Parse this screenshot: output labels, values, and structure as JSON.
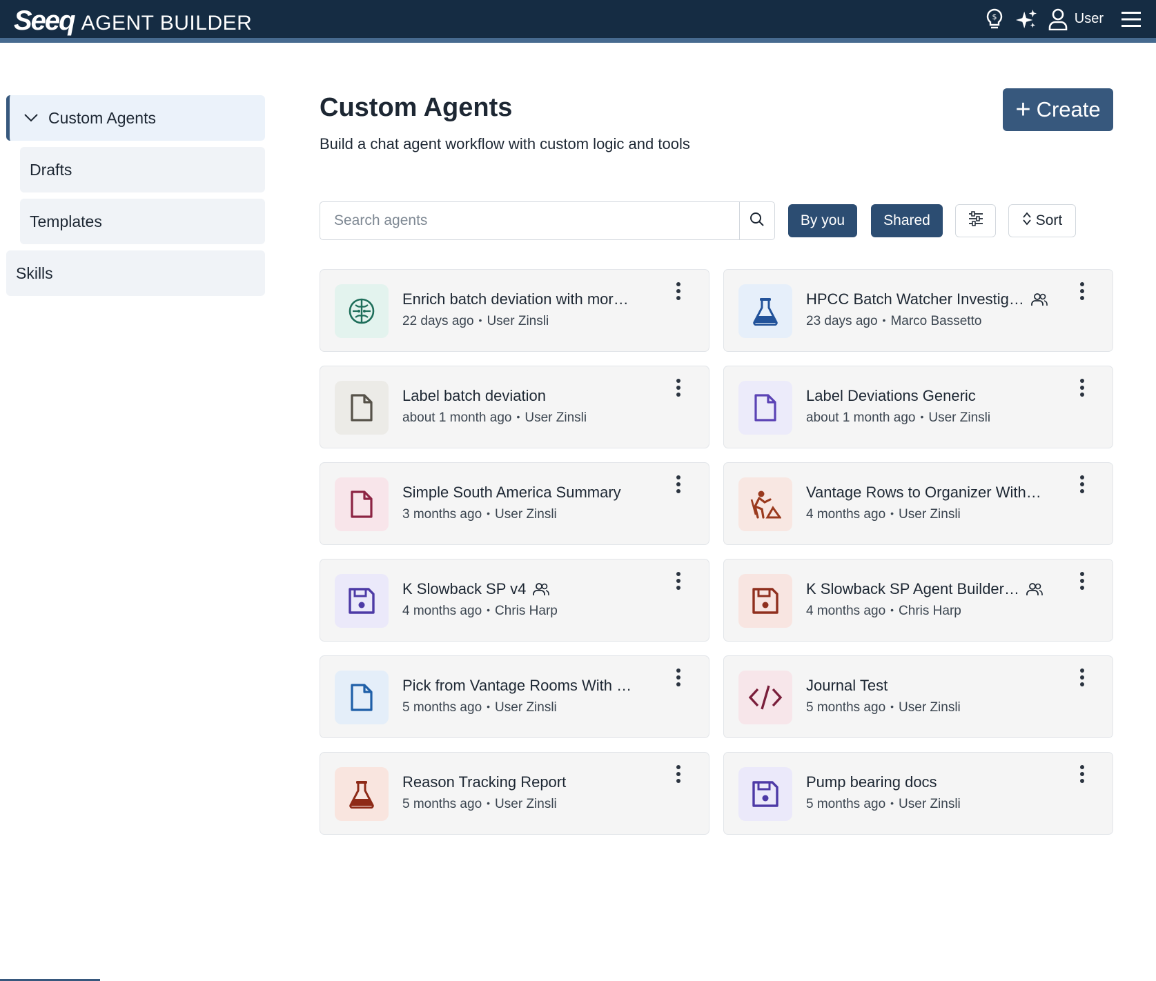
{
  "header": {
    "logo": "Seeq",
    "app_title": "AGENT BUILDER",
    "user_label": "User",
    "icons": [
      "lightbulb-dollar-icon",
      "sparkles-icon",
      "user-icon",
      "hamburger-menu-icon"
    ]
  },
  "sidebar": {
    "items": [
      {
        "label": "Custom Agents",
        "active": true
      },
      {
        "label": "Drafts"
      },
      {
        "label": "Templates"
      },
      {
        "label": "Skills"
      }
    ]
  },
  "main": {
    "title": "Custom Agents",
    "subtitle": "Build a chat agent workflow with custom logic and tools",
    "create_label": "Create",
    "search_placeholder": "Search agents",
    "filters": {
      "by_you": "By you",
      "shared": "Shared"
    },
    "sort_label": "Sort"
  },
  "cards": [
    {
      "title": "Enrich batch deviation with mor…",
      "age": "22 days ago",
      "author": "User Zinsli",
      "icon": "brain-icon",
      "icon_bg": "#e3f3ee",
      "icon_color": "#1e6e5a",
      "shared": false
    },
    {
      "title": "HPCC Batch Watcher Investig…",
      "age": "23 days ago",
      "author": "Marco Bassetto",
      "icon": "flask-icon",
      "icon_bg": "#e6effa",
      "icon_color": "#23539a",
      "shared": true
    },
    {
      "title": "Label batch deviation",
      "age": "about 1 month ago",
      "author": "User Zinsli",
      "icon": "file-icon",
      "icon_bg": "#ecebe7",
      "icon_color": "#565249",
      "shared": false
    },
    {
      "title": "Label Deviations Generic",
      "age": "about 1 month ago",
      "author": "User Zinsli",
      "icon": "file-icon",
      "icon_bg": "#ecebfa",
      "icon_color": "#5b43b5",
      "shared": false
    },
    {
      "title": "Simple South America Summary",
      "age": "3 months ago",
      "author": "User Zinsli",
      "icon": "file-icon",
      "icon_bg": "#f8e5ea",
      "icon_color": "#8c2443",
      "shared": false
    },
    {
      "title": "Vantage Rows to Organizer With…",
      "age": "4 months ago",
      "author": "User Zinsli",
      "icon": "person-digging-icon",
      "icon_bg": "#f8e7e2",
      "icon_color": "#9a3a1e",
      "shared": false
    },
    {
      "title": "K Slowback SP v4",
      "age": "4 months ago",
      "author": "Chris Harp",
      "icon": "floppy-disk-icon",
      "icon_bg": "#ebe9fa",
      "icon_color": "#4d3aa6",
      "shared": true
    },
    {
      "title": "K Slowback SP Agent Builder…",
      "age": "4 months ago",
      "author": "Chris Harp",
      "icon": "floppy-disk-icon",
      "icon_bg": "#f8e5e1",
      "icon_color": "#8f2f1e",
      "shared": true
    },
    {
      "title": "Pick from Vantage Rooms With …",
      "age": "5 months ago",
      "author": "User Zinsli",
      "icon": "file-icon",
      "icon_bg": "#e4eef9",
      "icon_color": "#1f5fa8",
      "shared": false
    },
    {
      "title": "Journal Test",
      "age": "5 months ago",
      "author": "User Zinsli",
      "icon": "code-icon",
      "icon_bg": "#f7e6ea",
      "icon_color": "#7a1f3b",
      "shared": false
    },
    {
      "title": "Reason Tracking Report",
      "age": "5 months ago",
      "author": "User Zinsli",
      "icon": "flask-icon",
      "icon_bg": "#f9e5df",
      "icon_color": "#8e2a17",
      "shared": false
    },
    {
      "title": "Pump bearing docs",
      "age": "5 months ago",
      "author": "User Zinsli",
      "icon": "floppy-disk-icon",
      "icon_bg": "#ebe9fa",
      "icon_color": "#4d3aa6",
      "shared": false
    }
  ]
}
